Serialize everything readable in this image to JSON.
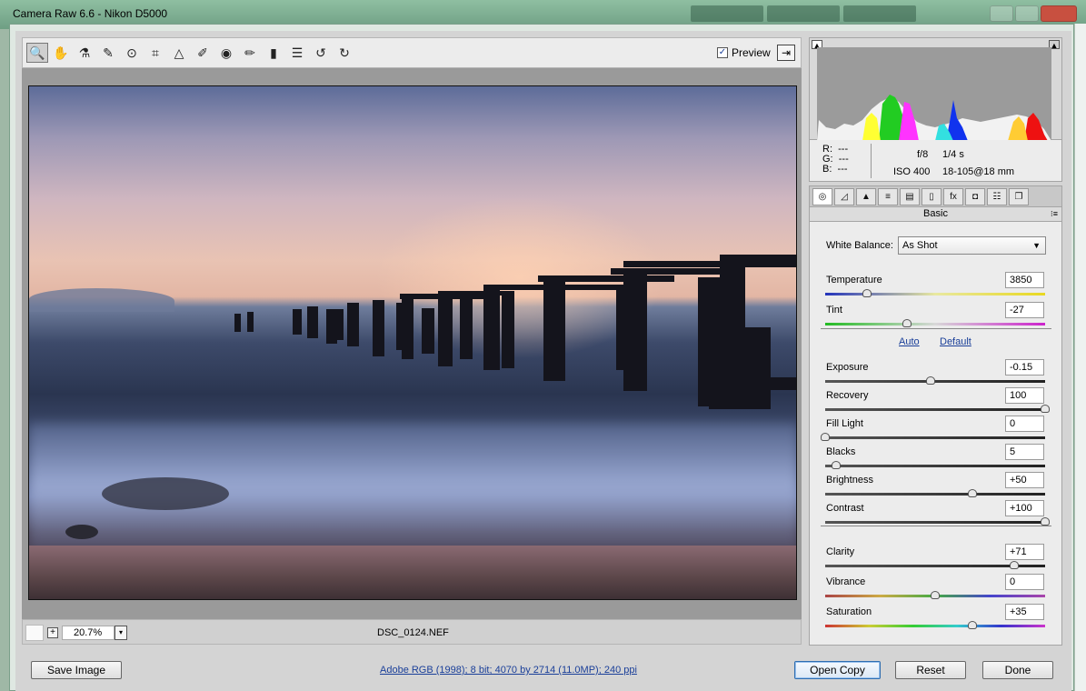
{
  "window": {
    "title": "Camera Raw 6.6  -  Nikon D5000"
  },
  "toolbar": {
    "tools": [
      {
        "name": "zoom-tool",
        "glyph": "🔍"
      },
      {
        "name": "hand-tool",
        "glyph": "✋"
      },
      {
        "name": "white-balance-tool",
        "glyph": "⚗"
      },
      {
        "name": "color-sampler-tool",
        "glyph": "✎"
      },
      {
        "name": "targeted-adjustment-tool",
        "glyph": "⊙"
      },
      {
        "name": "crop-tool",
        "glyph": "⌗"
      },
      {
        "name": "straighten-tool",
        "glyph": "△"
      },
      {
        "name": "spot-removal-tool",
        "glyph": "✐"
      },
      {
        "name": "red-eye-tool",
        "glyph": "◉"
      },
      {
        "name": "adjustment-brush-tool",
        "glyph": "✏"
      },
      {
        "name": "graduated-filter-tool",
        "glyph": "▮"
      },
      {
        "name": "preferences-tool",
        "glyph": "☰"
      },
      {
        "name": "rotate-left-tool",
        "glyph": "↺"
      },
      {
        "name": "rotate-right-tool",
        "glyph": "↻"
      }
    ],
    "preview_label": "Preview",
    "preview_checked": "✓",
    "fullscreen_glyph": "⇥"
  },
  "status": {
    "zoom": "20.7%",
    "filename": "DSC_0124.NEF",
    "plus": "+",
    "dropdown": "▾"
  },
  "histogram": {
    "clip_shadow": "▲",
    "clip_highlight": "▲"
  },
  "info": {
    "r_label": "R:",
    "r_value": "---",
    "g_label": "G:",
    "g_value": "---",
    "b_label": "B:",
    "b_value": "---",
    "aperture": "f/8",
    "shutter": "1/4 s",
    "iso": "ISO 400",
    "lens": "18-105@18 mm"
  },
  "panel_tabs": [
    {
      "name": "tab-basic",
      "glyph": "◎"
    },
    {
      "name": "tab-tone-curve",
      "glyph": "◿"
    },
    {
      "name": "tab-detail",
      "glyph": "▲"
    },
    {
      "name": "tab-hsl",
      "glyph": "≡"
    },
    {
      "name": "tab-split-toning",
      "glyph": "▤"
    },
    {
      "name": "tab-lens-corrections",
      "glyph": "▯"
    },
    {
      "name": "tab-effects",
      "glyph": "fx"
    },
    {
      "name": "tab-camera-calibration",
      "glyph": "◘"
    },
    {
      "name": "tab-presets",
      "glyph": "☷"
    },
    {
      "name": "tab-snapshots",
      "glyph": "❐"
    }
  ],
  "panel": {
    "title": "Basic",
    "menu_glyph": "⁝≡",
    "white_balance_label": "White Balance:",
    "white_balance_value": "As Shot",
    "auto_label": "Auto",
    "default_label": "Default",
    "sliders": {
      "temperature": {
        "label": "Temperature",
        "value": "3850",
        "position": 0.19
      },
      "tint": {
        "label": "Tint",
        "value": "-27",
        "position": 0.37
      },
      "exposure": {
        "label": "Exposure",
        "value": "-0.15",
        "position": 0.48
      },
      "recovery": {
        "label": "Recovery",
        "value": "100",
        "position": 1.0
      },
      "fill_light": {
        "label": "Fill Light",
        "value": "0",
        "position": 0.0
      },
      "blacks": {
        "label": "Blacks",
        "value": "5",
        "position": 0.05
      },
      "brightness": {
        "label": "Brightness",
        "value": "+50",
        "position": 0.67
      },
      "contrast": {
        "label": "Contrast",
        "value": "+100",
        "position": 1.0
      },
      "clarity": {
        "label": "Clarity",
        "value": "+71",
        "position": 0.86
      },
      "vibrance": {
        "label": "Vibrance",
        "value": "0",
        "position": 0.5
      },
      "saturation": {
        "label": "Saturation",
        "value": "+35",
        "position": 0.67
      }
    }
  },
  "footer": {
    "save_label": "Save Image",
    "workflow": "Adobe RGB (1998); 8 bit; 4070 by 2714 (11.0MP); 240 ppi",
    "open_label": "Open Copy",
    "reset_label": "Reset",
    "done_label": "Done"
  }
}
